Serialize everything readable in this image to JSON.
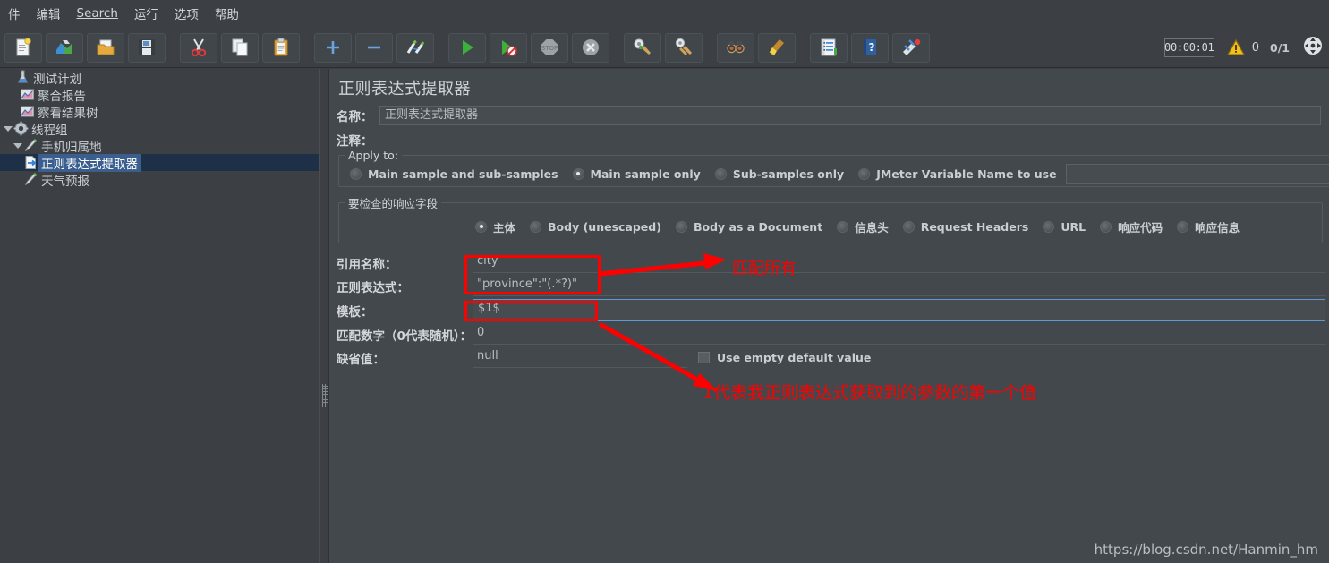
{
  "menu": {
    "items": [
      {
        "label": "件",
        "accel": ""
      },
      {
        "label": "编辑",
        "accel": ""
      },
      {
        "label": "Search",
        "accel": "S"
      },
      {
        "label": "运行",
        "accel": ""
      },
      {
        "label": "选项",
        "accel": ""
      },
      {
        "label": "帮助",
        "accel": ""
      }
    ]
  },
  "toolbar": {
    "buttons": [
      {
        "name": "new-icon",
        "title": "新建"
      },
      {
        "name": "templates-icon",
        "title": "模板"
      },
      {
        "name": "open-icon",
        "title": "打开"
      },
      {
        "name": "save-icon",
        "title": "保存"
      },
      {
        "name": "cut-icon",
        "title": "剪切"
      },
      {
        "name": "copy-icon",
        "title": "复制"
      },
      {
        "name": "paste-icon",
        "title": "粘贴"
      },
      {
        "name": "expand-icon",
        "title": "展开"
      },
      {
        "name": "collapse-icon",
        "title": "收起"
      },
      {
        "name": "toggle-icon",
        "title": "切换"
      },
      {
        "name": "start-icon",
        "title": "启动"
      },
      {
        "name": "start-no-pauses-icon",
        "title": "无间隔启动"
      },
      {
        "name": "stop-icon",
        "title": "停止"
      },
      {
        "name": "shutdown-icon",
        "title": "关闭"
      },
      {
        "name": "clear-icon",
        "title": "清除"
      },
      {
        "name": "clear-all-icon",
        "title": "清除全部"
      },
      {
        "name": "search-icon",
        "title": "查找"
      },
      {
        "name": "reset-search-icon",
        "title": "重置查找"
      },
      {
        "name": "function-helper-icon",
        "title": "函数助手"
      },
      {
        "name": "help-icon",
        "title": "帮助"
      },
      {
        "name": "undo-redo-icon",
        "title": "撤销"
      }
    ],
    "timer": "00:00:01",
    "warning_count": "0",
    "thread_count": "0/1",
    "warning_icon": "warning-triangle-icon",
    "expand_icon": "expand-arrows-icon"
  },
  "tree": {
    "items": [
      {
        "label": "测试计划",
        "icon": "test-plan-icon",
        "indent": 0,
        "twisty": "",
        "selected": false
      },
      {
        "label": "聚合报告",
        "icon": "aggregate-report-icon",
        "indent": 1,
        "twisty": "",
        "selected": false
      },
      {
        "label": "察看结果树",
        "icon": "view-results-tree-icon",
        "indent": 1,
        "twisty": "",
        "selected": false
      },
      {
        "label": "线程组",
        "icon": "thread-group-icon",
        "indent": 0,
        "twisty": "open",
        "selected": false
      },
      {
        "label": "手机归属地",
        "icon": "http-sampler-icon",
        "indent": 1,
        "twisty": "open",
        "selected": false
      },
      {
        "label": "正则表达式提取器",
        "icon": "regex-extractor-icon",
        "indent": 2,
        "twisty": "",
        "selected": true
      },
      {
        "label": "天气预报",
        "icon": "http-sampler-icon",
        "indent": 1,
        "twisty": "",
        "selected": false
      }
    ]
  },
  "detail": {
    "title": "正则表达式提取器",
    "name_label": "名称：",
    "name_value": "正则表达式提取器",
    "comment_label": "注释：",
    "comment_value": "",
    "apply_to": {
      "legend": "Apply to:",
      "options": [
        {
          "label": "Main sample and sub-samples",
          "checked": false
        },
        {
          "label": "Main sample only",
          "checked": true
        },
        {
          "label": "Sub-samples only",
          "checked": false
        },
        {
          "label": "JMeter Variable Name to use",
          "checked": false
        }
      ],
      "variable_value": ""
    },
    "response_field": {
      "legend": "要检查的响应字段",
      "options": [
        {
          "label": "主体",
          "checked": true
        },
        {
          "label": "Body (unescaped)",
          "checked": false
        },
        {
          "label": "Body as a Document",
          "checked": false
        },
        {
          "label": "信息头",
          "checked": false
        },
        {
          "label": "Request Headers",
          "checked": false
        },
        {
          "label": "URL",
          "checked": false
        },
        {
          "label": "响应代码",
          "checked": false
        },
        {
          "label": "响应信息",
          "checked": false
        }
      ]
    },
    "fields": {
      "ref_name_label": "引用名称：",
      "ref_name_value": "city",
      "regex_label": "正则表达式：",
      "regex_value": "\"province\":\"(.*?)\"",
      "template_label": "模板：",
      "template_value": "$1$",
      "match_no_label": "匹配数字（0代表随机）：",
      "match_no_value": "0",
      "default_label": "缺省值：",
      "default_value": "null",
      "use_empty_label": "Use empty default value",
      "use_empty_checked": false
    }
  },
  "annotations": {
    "color": "#fe0000",
    "note_match_all": "匹配所有",
    "note_first_value": "1代表我正则表达式获取到的参数的第一个值"
  },
  "watermark": "https://blog.csdn.net/Hanmin_hm"
}
